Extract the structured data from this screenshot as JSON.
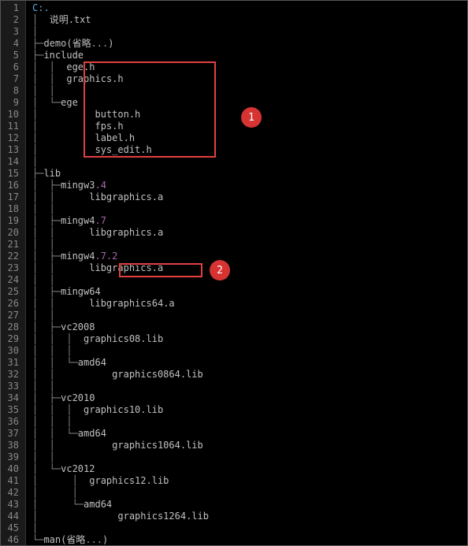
{
  "callouts": {
    "c1": "1",
    "c2": "2"
  },
  "lines": [
    {
      "n": "1",
      "pre": "",
      "txt": "C:.",
      "cls": "root"
    },
    {
      "n": "2",
      "pre": "│  ",
      "txt": "说明.txt",
      "cls": "fname"
    },
    {
      "n": "3",
      "pre": "│",
      "txt": "",
      "cls": ""
    },
    {
      "n": "4",
      "pre": "├─",
      "txt": "demo(省略",
      "cls": "fname",
      "trail": "...",
      "trailcls": "ellipsis",
      "close": ")"
    },
    {
      "n": "5",
      "pre": "├─",
      "txt": "include",
      "cls": "fname"
    },
    {
      "n": "6",
      "pre": "│  │  ",
      "txt": "ege.h",
      "cls": "fname"
    },
    {
      "n": "7",
      "pre": "│  │  ",
      "txt": "graphics.h",
      "cls": "fname"
    },
    {
      "n": "8",
      "pre": "│  │",
      "txt": "",
      "cls": ""
    },
    {
      "n": "9",
      "pre": "│  └─",
      "txt": "ege",
      "cls": "fname"
    },
    {
      "n": "10",
      "pre": "│          ",
      "txt": "button.h",
      "cls": "fname"
    },
    {
      "n": "11",
      "pre": "│          ",
      "txt": "fps.h",
      "cls": "fname"
    },
    {
      "n": "12",
      "pre": "│          ",
      "txt": "label.h",
      "cls": "fname"
    },
    {
      "n": "13",
      "pre": "│          ",
      "txt": "sys_edit.h",
      "cls": "fname"
    },
    {
      "n": "14",
      "pre": "│",
      "txt": "",
      "cls": ""
    },
    {
      "n": "15",
      "pre": "├─",
      "txt": "lib",
      "cls": "fname"
    },
    {
      "n": "16",
      "pre": "│  ├─",
      "txt": "mingw3",
      "cls": "fname",
      "trail": ".4",
      "trailcls": "num"
    },
    {
      "n": "17",
      "pre": "│  │      ",
      "txt": "libgraphics.a",
      "cls": "fname"
    },
    {
      "n": "18",
      "pre": "│  │",
      "txt": "",
      "cls": ""
    },
    {
      "n": "19",
      "pre": "│  ├─",
      "txt": "mingw4",
      "cls": "fname",
      "trail": ".7",
      "trailcls": "num"
    },
    {
      "n": "20",
      "pre": "│  │      ",
      "txt": "libgraphics.a",
      "cls": "fname"
    },
    {
      "n": "21",
      "pre": "│  │",
      "txt": "",
      "cls": ""
    },
    {
      "n": "22",
      "pre": "│  ├─",
      "txt": "mingw4",
      "cls": "fname",
      "trail": ".7.2",
      "trailcls": "num"
    },
    {
      "n": "23",
      "pre": "│  │      ",
      "txt": "libgraphics.a",
      "cls": "fname"
    },
    {
      "n": "24",
      "pre": "│  │",
      "txt": "",
      "cls": ""
    },
    {
      "n": "25",
      "pre": "│  ├─",
      "txt": "mingw64",
      "cls": "fname"
    },
    {
      "n": "26",
      "pre": "│  │      ",
      "txt": "libgraphics64.a",
      "cls": "fname"
    },
    {
      "n": "27",
      "pre": "│  │",
      "txt": "",
      "cls": ""
    },
    {
      "n": "28",
      "pre": "│  ├─",
      "txt": "vc2008",
      "cls": "fname"
    },
    {
      "n": "29",
      "pre": "│  │  │  ",
      "txt": "graphics08.lib",
      "cls": "fname"
    },
    {
      "n": "30",
      "pre": "│  │  │",
      "txt": "",
      "cls": ""
    },
    {
      "n": "31",
      "pre": "│  │  └─",
      "txt": "amd64",
      "cls": "fname"
    },
    {
      "n": "32",
      "pre": "│  │          ",
      "txt": "graphics0864.lib",
      "cls": "fname"
    },
    {
      "n": "33",
      "pre": "│  │",
      "txt": "",
      "cls": ""
    },
    {
      "n": "34",
      "pre": "│  ├─",
      "txt": "vc2010",
      "cls": "fname"
    },
    {
      "n": "35",
      "pre": "│  │  │  ",
      "txt": "graphics10.lib",
      "cls": "fname"
    },
    {
      "n": "36",
      "pre": "│  │  │",
      "txt": "",
      "cls": ""
    },
    {
      "n": "37",
      "pre": "│  │  └─",
      "txt": "amd64",
      "cls": "fname"
    },
    {
      "n": "38",
      "pre": "│  │          ",
      "txt": "graphics1064.lib",
      "cls": "fname"
    },
    {
      "n": "39",
      "pre": "│  │",
      "txt": "",
      "cls": ""
    },
    {
      "n": "40",
      "pre": "│  └─",
      "txt": "vc2012",
      "cls": "fname"
    },
    {
      "n": "41",
      "pre": "│      │  ",
      "txt": "graphics12.lib",
      "cls": "fname"
    },
    {
      "n": "42",
      "pre": "│      │",
      "txt": "",
      "cls": ""
    },
    {
      "n": "43",
      "pre": "│      └─",
      "txt": "amd64",
      "cls": "fname"
    },
    {
      "n": "44",
      "pre": "│              ",
      "txt": "graphics1264.lib",
      "cls": "fname"
    },
    {
      "n": "45",
      "pre": "│",
      "txt": "",
      "cls": ""
    },
    {
      "n": "46",
      "pre": "└─",
      "txt": "man(省略",
      "cls": "fname",
      "trail": "...",
      "trailcls": "ellipsis",
      "close": ")"
    }
  ]
}
